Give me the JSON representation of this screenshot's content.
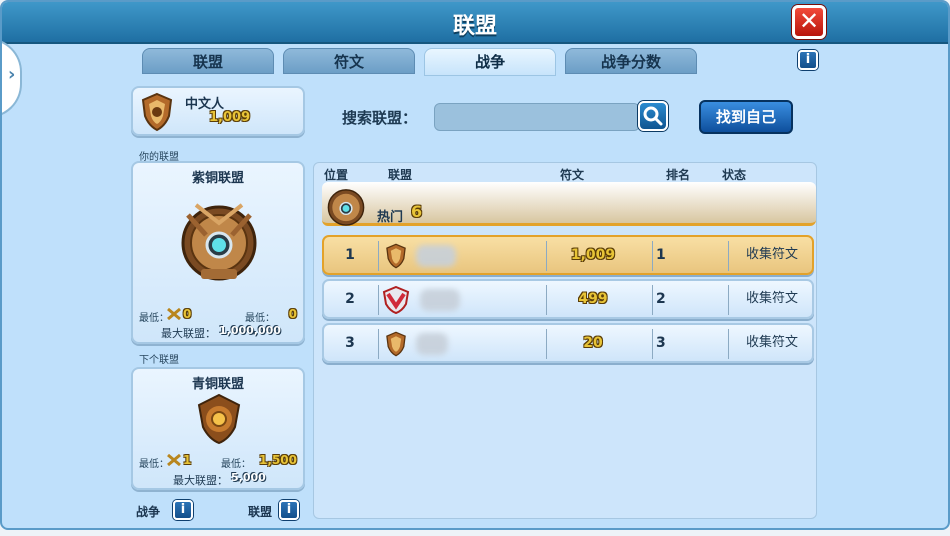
{
  "window": {
    "title": "联盟",
    "close_icon": "close-icon"
  },
  "tabs": [
    {
      "label": "联盟",
      "active": false
    },
    {
      "label": "符文",
      "active": false
    },
    {
      "label": "战争",
      "active": true
    },
    {
      "label": "战争分数",
      "active": false
    }
  ],
  "player": {
    "name": "中文人",
    "score": "1,009"
  },
  "your_league": {
    "section_label": "你的联盟",
    "name": "紫铜联盟",
    "min_left_label": "最低：",
    "min_left_value": "0",
    "min_right_label": "最低：",
    "min_right_value": "0",
    "max_label": "最大联盟：",
    "max_value": "1,000,000"
  },
  "next_league": {
    "section_label": "下个联盟",
    "name": "青铜联盟",
    "min_left_label": "最低：",
    "min_left_value": "1",
    "min_right_label": "最低：",
    "min_right_value": "1,500",
    "max_label": "最大联盟：",
    "max_value": "5,000"
  },
  "footer": {
    "war_label": "战争",
    "league_label": "联盟"
  },
  "search": {
    "label": "搜索联盟：",
    "placeholder": "",
    "find_self_label": "找到自己"
  },
  "table": {
    "headers": {
      "position": "位置",
      "league": "联盟",
      "runes": "符文",
      "rank": "排名",
      "status": "状态"
    },
    "hot": {
      "label": "热门",
      "count": "6"
    },
    "rows": [
      {
        "position": "1",
        "runes": "1,009",
        "rank": "1",
        "status": "收集符文",
        "highlight": true
      },
      {
        "position": "2",
        "runes": "499",
        "rank": "2",
        "status": "收集符文",
        "highlight": false
      },
      {
        "position": "3",
        "runes": "20",
        "rank": "3",
        "status": "收集符文",
        "highlight": false
      }
    ]
  },
  "colors": {
    "accent_gold": "#e8c437",
    "frame_blue": "#1f6fa3",
    "close_red": "#d9261a",
    "highlight_row": "#f0d08e"
  }
}
